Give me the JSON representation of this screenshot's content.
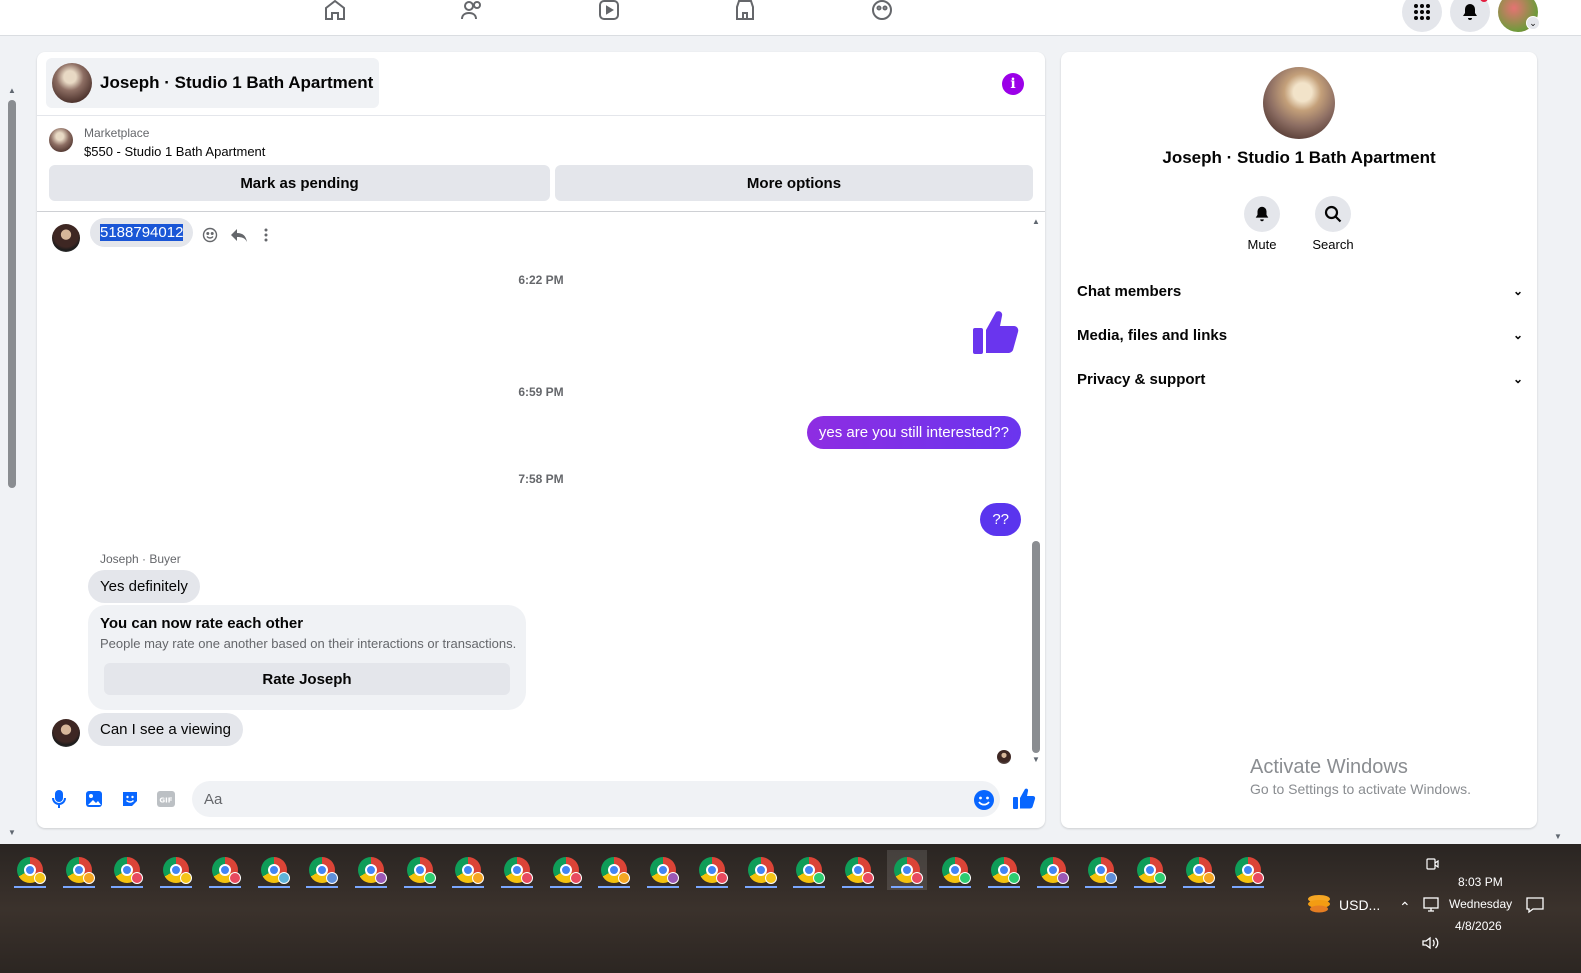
{
  "chat": {
    "title": "Joseph · Studio 1 Bath Apartment",
    "marketplace_label": "Marketplace",
    "listing": "$550 - Studio 1 Bath Apartment",
    "mark_pending": "Mark as pending",
    "more_options": "More options"
  },
  "messages": {
    "phone": "5188794012",
    "ts1": "6:22 PM",
    "ts2": "6:59 PM",
    "out1": "yes are you still interested??",
    "ts3": "7:58 PM",
    "out2": "??",
    "sender": "Joseph · Buyer",
    "in1": "Yes definitely",
    "rate_title": "You can now rate each other",
    "rate_sub": "People may rate one another based on their interactions or transactions.",
    "rate_btn": "Rate Joseph",
    "in2": "Can I see a viewing"
  },
  "composer": {
    "placeholder": "Aa"
  },
  "side": {
    "title": "Joseph · Studio 1 Bath Apartment",
    "mute": "Mute",
    "search": "Search",
    "sections": [
      "Chat members",
      "Media, files and links",
      "Privacy & support"
    ]
  },
  "watermark": {
    "line1": "Activate Windows",
    "line2": "Go to Settings to activate Windows."
  },
  "taskbar": {
    "tray_label": "USD...",
    "time": "8:03 PM",
    "day": "Wednesday",
    "date": "4/8/2026"
  },
  "colors": {
    "accent": "#0866ff",
    "outgoing": "#7b2ff7",
    "info": "#9b00e8"
  }
}
